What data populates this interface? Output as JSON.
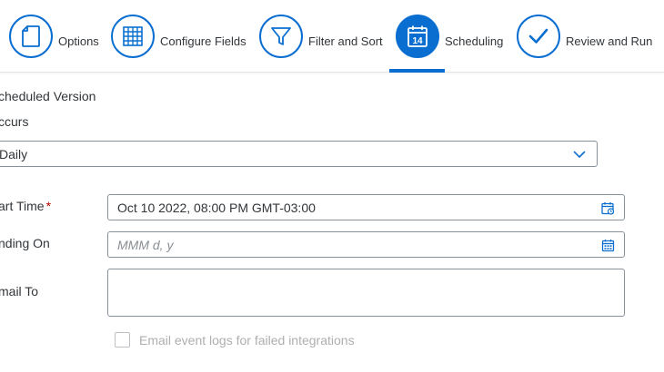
{
  "wizard": {
    "steps": [
      {
        "label": "Options",
        "icon": "document-icon",
        "active": false
      },
      {
        "label": "Configure Fields",
        "icon": "table-grid-icon",
        "active": false
      },
      {
        "label": "Filter and Sort",
        "icon": "filter-icon",
        "active": false
      },
      {
        "label": "Scheduling",
        "icon": "calendar-14-icon",
        "calendar_day": "14",
        "active": true
      },
      {
        "label": "Review and Run",
        "icon": "checkmark-icon",
        "active": false
      }
    ],
    "accent_color": "#0a6ed1"
  },
  "form": {
    "section_title": "cheduled Version",
    "occurs": {
      "label": "ccurs",
      "value": "Daily"
    },
    "start_time": {
      "label": "art Time",
      "required_marker": "*",
      "value": "Oct 10 2022, 08:00 PM GMT-03:00"
    },
    "ending_on": {
      "label": "nding On",
      "placeholder": "MMM d, y",
      "value": ""
    },
    "email_to": {
      "label": "mail To",
      "value": ""
    },
    "email_logs_checkbox": {
      "label": "Email event logs for failed integrations",
      "checked": false,
      "enabled": false
    }
  }
}
